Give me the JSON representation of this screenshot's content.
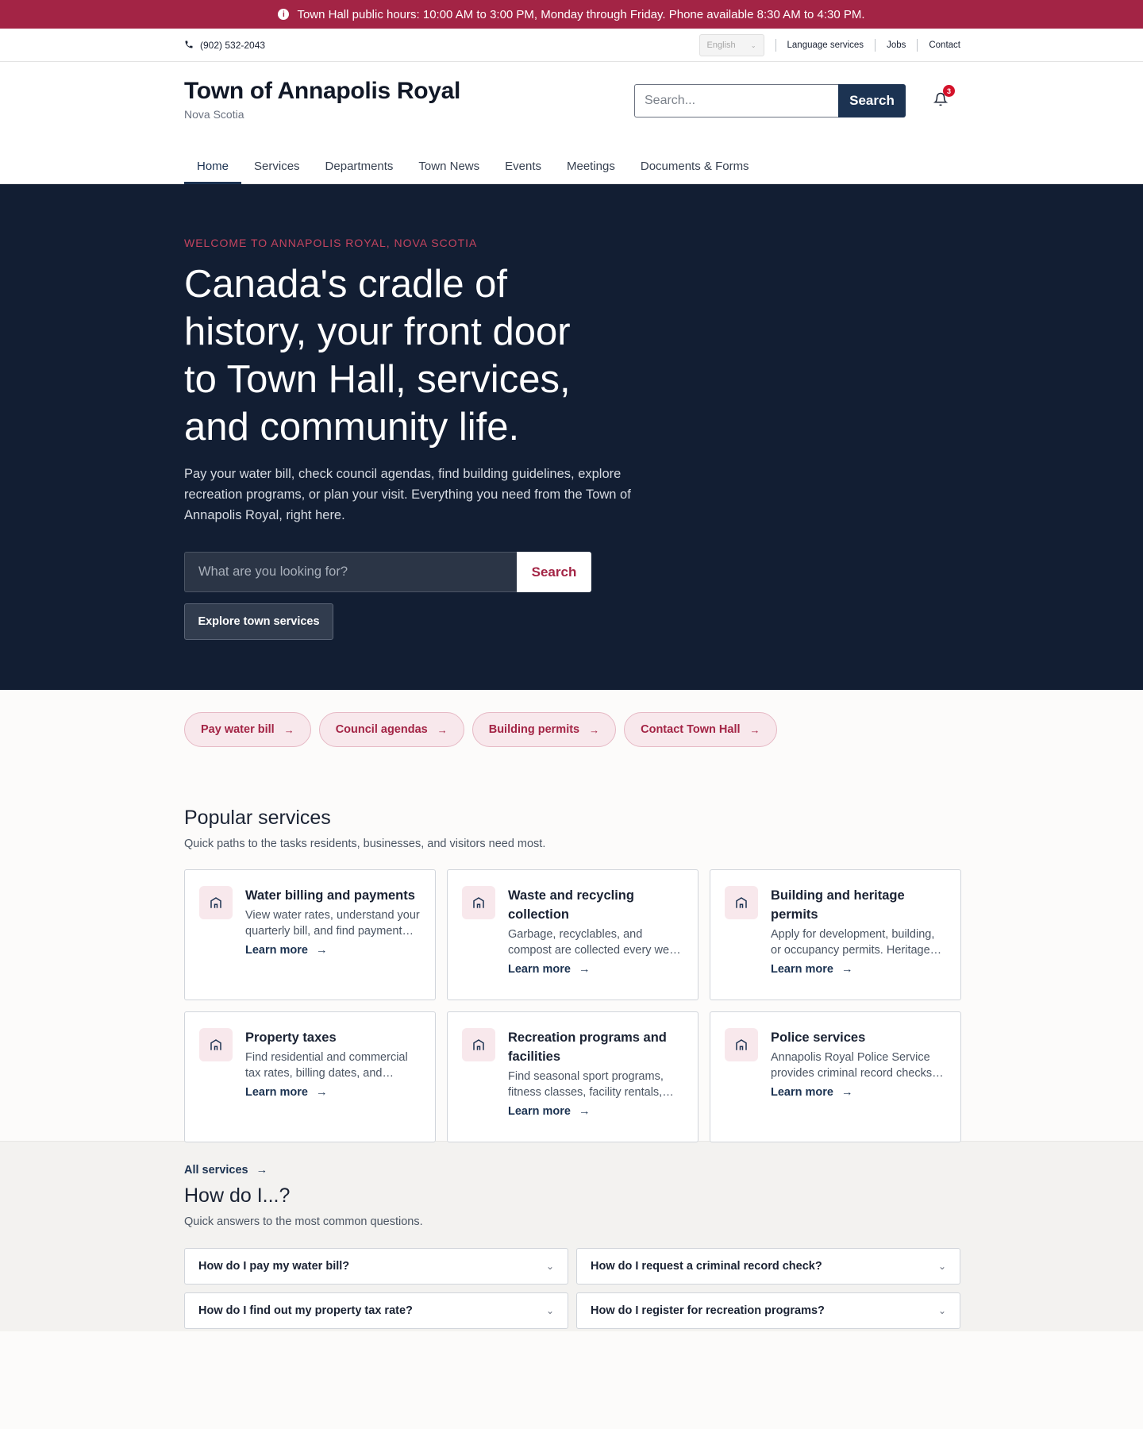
{
  "alert": {
    "icon": "info-icon",
    "text": "Town Hall public hours: 10:00 AM to 3:00 PM, Monday through Friday. Phone available 8:30 AM to 4:30 PM."
  },
  "utility": {
    "phone": "(902) 532-2043",
    "language": "English",
    "links": [
      "Language services",
      "Jobs",
      "Contact"
    ]
  },
  "header": {
    "title": "Town of Annapolis Royal",
    "subtitle": "Nova Scotia",
    "search_placeholder": "Search...",
    "search_button": "Search",
    "notification_count": "3"
  },
  "nav": {
    "items": [
      "Home",
      "Services",
      "Departments",
      "Town News",
      "Events",
      "Meetings",
      "Documents & Forms"
    ],
    "active": "Home"
  },
  "hero": {
    "eyebrow": "WELCOME TO ANNAPOLIS ROYAL, NOVA SCOTIA",
    "title": "Canada's cradle of history, your front door to Town Hall, services, and community life.",
    "text": "Pay your water bill, check council agendas, find building guidelines, explore recreation programs, or plan your visit. Everything you need from the Town of Annapolis Royal, right here.",
    "search_placeholder": "What are you looking for?",
    "search_button": "Search",
    "cta": "Explore town services"
  },
  "quick_links": [
    "Pay water bill",
    "Council agendas",
    "Building permits",
    "Contact Town Hall"
  ],
  "services": {
    "title": "Popular services",
    "subtitle": "Quick paths to the tasks residents, businesses, and visitors need most.",
    "link_label": "Learn more",
    "cards": [
      {
        "title": "Water billing and payments",
        "desc": "View water rates, understand your quarterly bill, and find payment options."
      },
      {
        "title": "Waste and recycling collection",
        "desc": "Garbage, recyclables, and compost are collected every week on a set schedule."
      },
      {
        "title": "Building and heritage permits",
        "desc": "Apply for development, building, or occupancy permits. Heritage properties require review."
      },
      {
        "title": "Property taxes",
        "desc": "Find residential and commercial tax rates, billing dates, and payment options."
      },
      {
        "title": "Recreation programs and facilities",
        "desc": "Find seasonal sport programs, fitness classes, facility rentals, and more."
      },
      {
        "title": "Police services",
        "desc": "Annapolis Royal Police Service provides criminal record checks and community policing."
      }
    ],
    "all_link": "All services"
  },
  "faq": {
    "title": "How do I...?",
    "subtitle": "Quick answers to the most common questions.",
    "items": [
      "How do I pay my water bill?",
      "How do I request a criminal record check?",
      "How do I find out my property tax rate?",
      "How do I register for recreation programs?"
    ]
  },
  "colors": {
    "brand_red": "#a32445",
    "navy": "#1c3352",
    "hero_bg": "#121e33"
  }
}
